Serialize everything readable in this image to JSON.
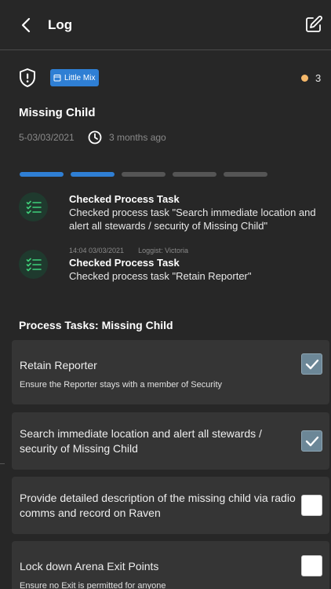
{
  "header": {
    "title": "Log",
    "back_icon": "chevron-left-icon",
    "edit_icon": "edit-square-icon"
  },
  "incident": {
    "priority_icon": "shield-alert-icon",
    "tag_label": "Little Mix",
    "tag_color": "#2f7fd4",
    "status_dot_color": "#f5b86a",
    "status_count": "3",
    "title": "Missing Child",
    "reference": "5-03/03/2021",
    "time_ago": "3 months ago"
  },
  "progress": {
    "completed_steps": 2,
    "total_steps": 5,
    "done_color": "#2f7fd4"
  },
  "log_entries": [
    {
      "icon": "checklist-icon",
      "meta_time": "",
      "meta_loggist": "",
      "title": "Checked Process Task",
      "description": "Checked process task \"Search immediate location and alert all stewards / security of Missing Child\""
    },
    {
      "icon": "checklist-icon",
      "meta_time": "14:04 03/03/2021",
      "meta_loggist": "Loggist: Victoria",
      "title": "Checked Process Task",
      "description": "Checked process task \"Retain Reporter\""
    }
  ],
  "process": {
    "section_title": "Process Tasks: Missing Child",
    "tasks": [
      {
        "name": "Retain Reporter",
        "note": "Ensure the Reporter stays with a member of Security",
        "checked": true
      },
      {
        "name": "Search immediate location and alert all stewards / security of Missing Child",
        "note": "",
        "checked": true
      },
      {
        "name": "Provide detailed description of the missing child via radio comms and record on Raven",
        "note": "",
        "checked": false
      },
      {
        "name": "Lock down Arena Exit Points",
        "note": "Ensure no Exit is permitted for anyone",
        "checked": false
      }
    ]
  }
}
